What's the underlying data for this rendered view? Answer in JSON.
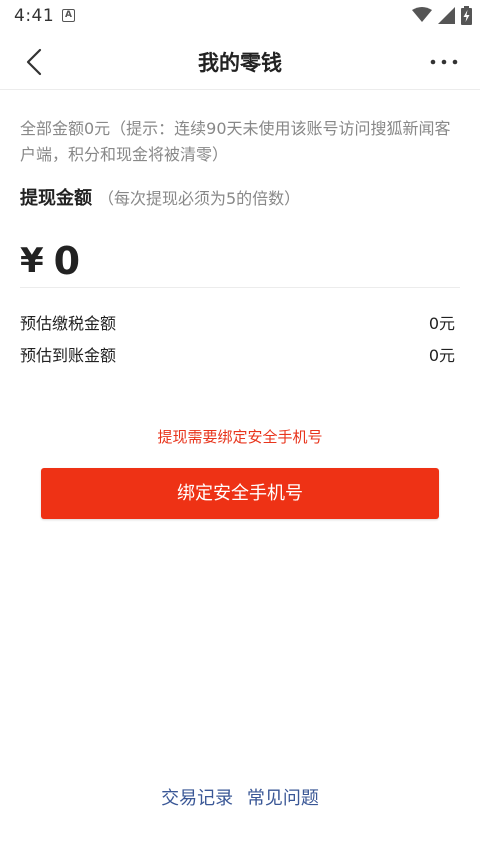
{
  "status_bar": {
    "time": "4:41",
    "notification_icon": "a-letter-icon",
    "icons": [
      "wifi-icon",
      "signal-icon",
      "battery-charging-icon"
    ]
  },
  "header": {
    "title": "我的零钱",
    "back_icon": "chevron-left-icon",
    "more_icon": "more-horizontal-icon"
  },
  "notice": "全部金额0元（提示：连续90天未使用该账号访问搜狐新闻客户端，积分和现金将被清零）",
  "withdraw": {
    "label": "提现金额",
    "hint": "（每次提现必须为5的倍数）",
    "currency_symbol": "¥",
    "amount": "0"
  },
  "summary": [
    {
      "label": "预估缴税金额",
      "value": "0元"
    },
    {
      "label": "预估到账金额",
      "value": "0元"
    }
  ],
  "bind": {
    "hint": "提现需要绑定安全手机号",
    "button_label": "绑定安全手机号"
  },
  "footer": {
    "transactions_label": "交易记录",
    "faq_label": "常见问题"
  },
  "colors": {
    "accent": "#ee3215",
    "hint_red": "#e8341c",
    "link_blue": "#3a5796"
  }
}
